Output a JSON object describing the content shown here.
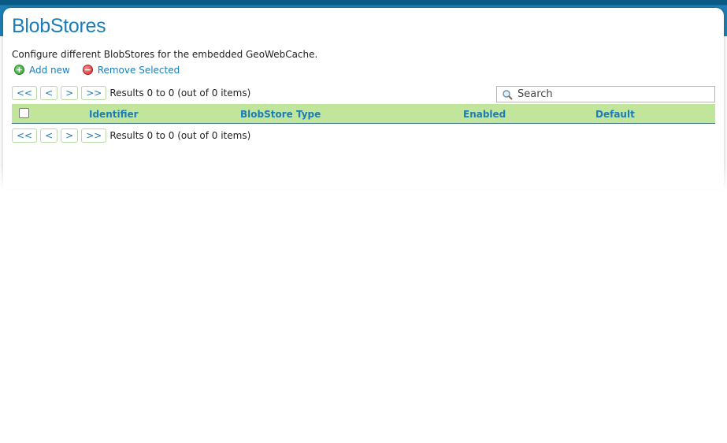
{
  "page": {
    "title": "BlobStores",
    "description": "Configure different BlobStores for the embedded GeoWebCache."
  },
  "actions": {
    "add_label": "Add new",
    "remove_label": "Remove Selected"
  },
  "pager": {
    "first": "<<",
    "prev": "<",
    "next": ">",
    "last": ">>",
    "results_text": "Results 0 to 0 (out of 0 items)"
  },
  "search": {
    "placeholder": "Search",
    "value": ""
  },
  "table": {
    "columns": [
      "Identifier",
      "BlobStore Type",
      "Enabled",
      "Default"
    ],
    "rows": []
  },
  "colors": {
    "accent": "#1b7db8",
    "header_bar": "#1d7fb5",
    "table_header": "#c2e59c"
  }
}
